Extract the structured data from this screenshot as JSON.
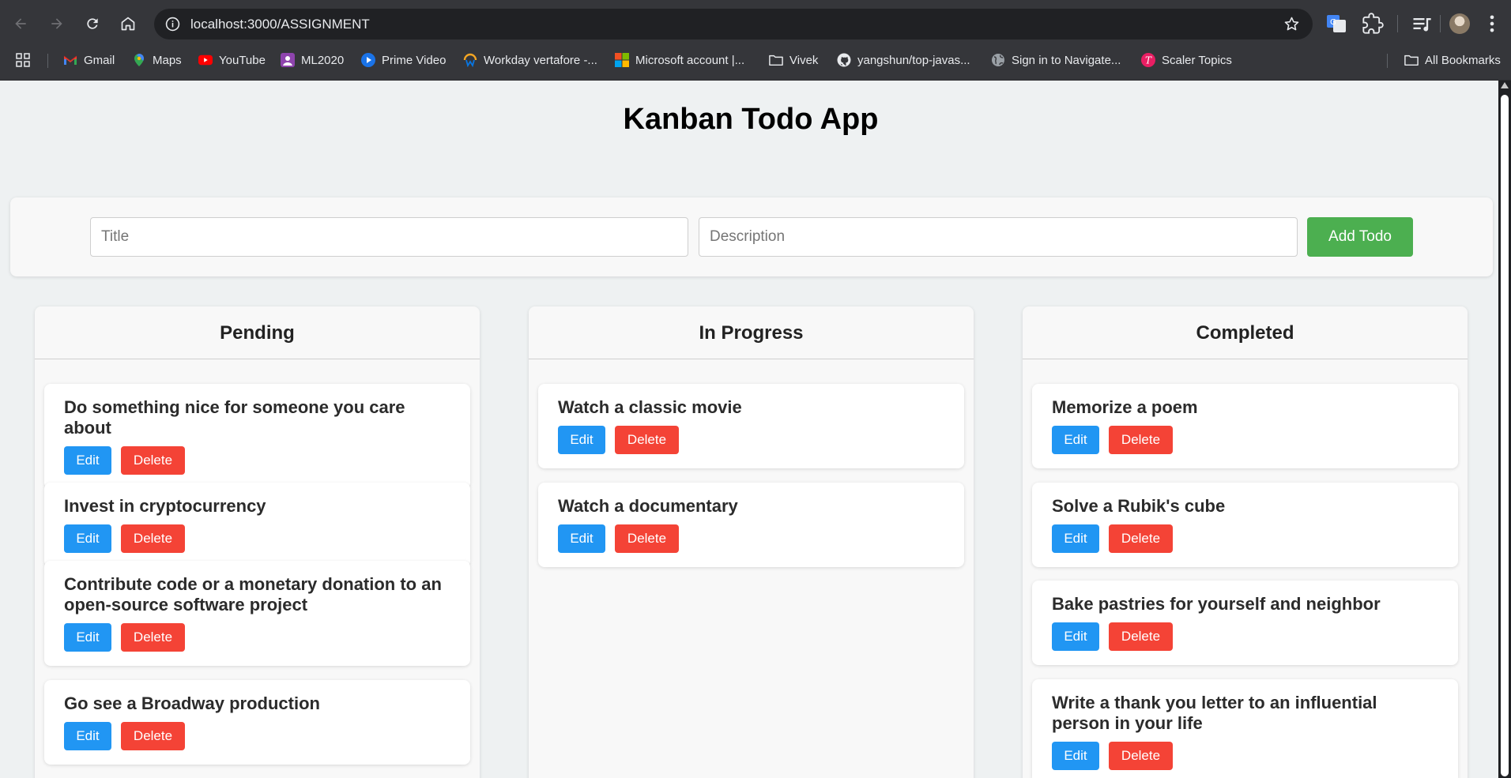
{
  "browser": {
    "url": "localhost:3000/ASSIGNMENT",
    "bookmarks": [
      {
        "label": "Gmail",
        "icon": "gmail-icon"
      },
      {
        "label": "Maps",
        "icon": "maps-icon"
      },
      {
        "label": "YouTube",
        "icon": "youtube-icon"
      },
      {
        "label": "ML2020",
        "icon": "ml2020-icon"
      },
      {
        "label": "Prime Video",
        "icon": "prime-video-icon"
      },
      {
        "label": "Workday vertafore -...",
        "icon": "workday-icon"
      },
      {
        "label": "Microsoft account |...",
        "icon": "microsoft-icon"
      },
      {
        "label": "Vivek",
        "icon": "folder-icon"
      },
      {
        "label": "yangshun/top-javas...",
        "icon": "github-icon"
      },
      {
        "label": "Sign in to Navigate...",
        "icon": "globe-icon"
      },
      {
        "label": "Scaler Topics",
        "icon": "scaler-icon"
      }
    ],
    "all_bookmarks": "All Bookmarks"
  },
  "app": {
    "title": "Kanban Todo App",
    "form": {
      "title_placeholder": "Title",
      "description_placeholder": "Description",
      "add_label": "Add Todo"
    },
    "columns": [
      {
        "name": "Pending",
        "tasks": [
          "Do something nice for someone you care about",
          "Invest in cryptocurrency",
          "Contribute code or a monetary donation to an open-source software project",
          "Go see a Broadway production"
        ]
      },
      {
        "name": "In Progress",
        "tasks": [
          "Watch a classic movie",
          "Watch a documentary"
        ]
      },
      {
        "name": "Completed",
        "tasks": [
          "Memorize a poem",
          "Solve a Rubik's cube",
          "Bake pastries for yourself and neighbor",
          "Write a thank you letter to an influential person in your life"
        ]
      }
    ],
    "edit_label": "Edit",
    "delete_label": "Delete"
  },
  "colors": {
    "add_button": "#4caf50",
    "edit_button": "#2196f3",
    "delete_button": "#f44336",
    "page_background": "#eef1f2"
  }
}
